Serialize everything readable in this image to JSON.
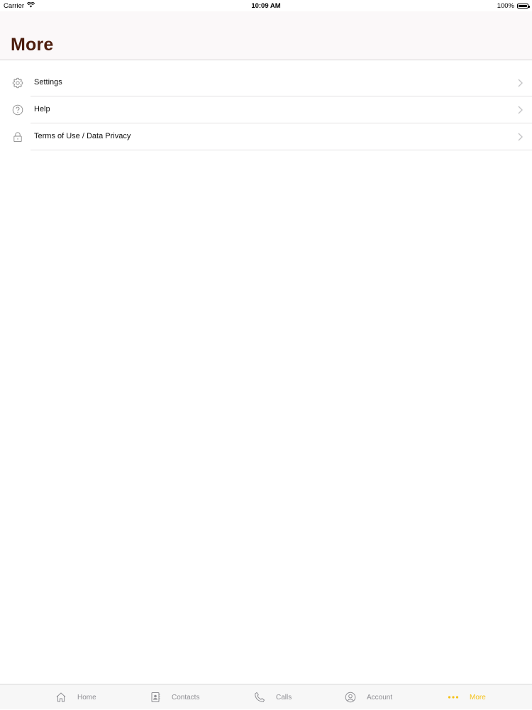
{
  "status_bar": {
    "carrier": "Carrier",
    "time": "10:09 AM",
    "battery": "100%"
  },
  "header": {
    "title": "More",
    "title_color": "#4d1e0f"
  },
  "menu": {
    "items": [
      {
        "label": "Settings",
        "icon": "gear-icon"
      },
      {
        "label": "Help",
        "icon": "question-circle-icon"
      },
      {
        "label": "Terms of Use / Data Privacy",
        "icon": "lock-icon"
      }
    ]
  },
  "tab_bar": {
    "active_color": "#f4c118",
    "inactive_color": "#8e8e93",
    "tabs": [
      {
        "label": "Home",
        "icon": "home-icon",
        "active": false
      },
      {
        "label": "Contacts",
        "icon": "contacts-book-icon",
        "active": false
      },
      {
        "label": "Calls",
        "icon": "phone-icon",
        "active": false
      },
      {
        "label": "Account",
        "icon": "account-circle-icon",
        "active": false
      },
      {
        "label": "More",
        "icon": "more-dots-icon",
        "active": true
      }
    ]
  }
}
